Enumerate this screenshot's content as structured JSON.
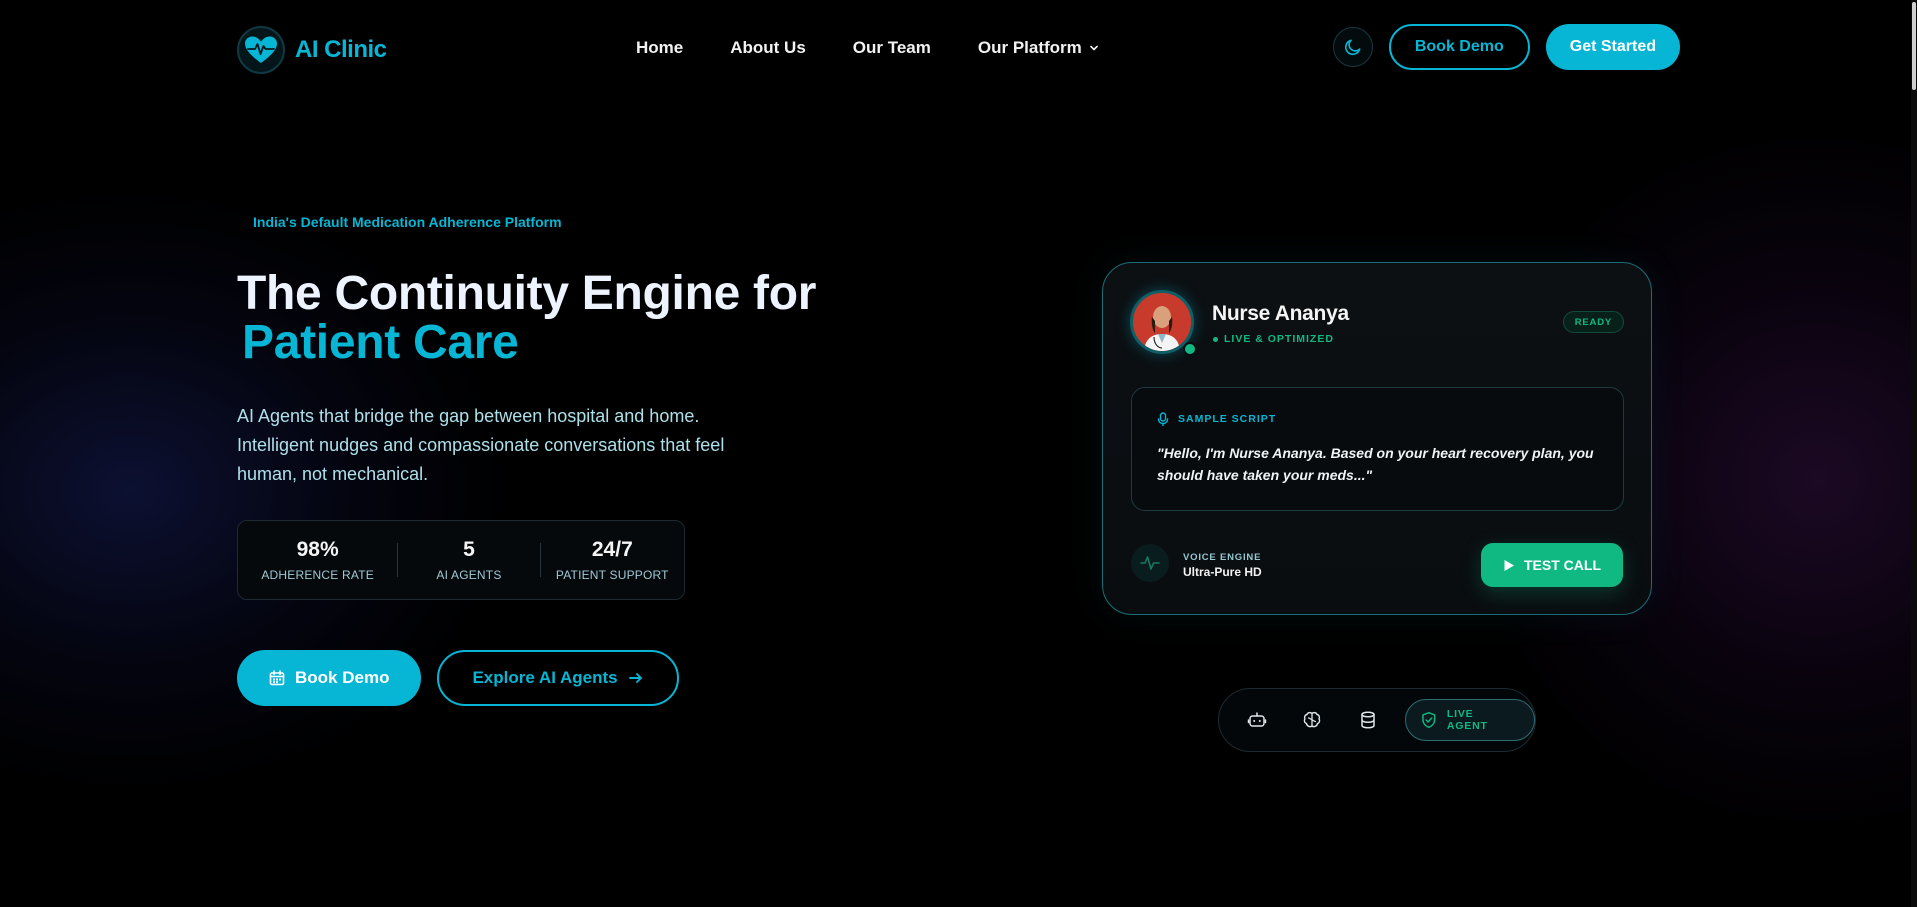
{
  "brand": {
    "name": "AI Clinic",
    "logo_icon": "heart-pulse-icon",
    "color": "#06b6d4"
  },
  "nav": {
    "links": [
      {
        "label": "Home"
      },
      {
        "label": "About Us"
      },
      {
        "label": "Our Team"
      },
      {
        "label": "Our Platform",
        "has_dropdown": true
      }
    ],
    "theme_toggle_icon": "moon-icon",
    "book_demo": "Book Demo",
    "get_started": "Get Started"
  },
  "hero": {
    "eyebrow": "India's Default Medication Adherence Platform",
    "title_line1": "The Continuity Engine for",
    "title_line2": "Patient Care",
    "subtitle": "AI Agents that bridge the gap between hospital and home. Intelligent nudges and compassionate conversations that feel human, not mechanical.",
    "stats": [
      {
        "value": "98%",
        "label": "ADHERENCE RATE"
      },
      {
        "value": "5",
        "label": "AI AGENTS"
      },
      {
        "value": "24/7",
        "label": "PATIENT SUPPORT"
      }
    ],
    "cta_primary": "Book Demo",
    "cta_primary_icon": "calendar-icon",
    "cta_secondary": "Explore AI Agents",
    "cta_secondary_icon": "arrow-right-icon"
  },
  "agent_card": {
    "name": "Nurse Ananya",
    "status": "LIVE & OPTIMIZED",
    "badge": "READY",
    "script_label": "SAMPLE SCRIPT",
    "script_text": "\"Hello, I'm Nurse Ananya. Based on your heart recovery plan, you should have taken your meds...\"",
    "engine_label": "VOICE ENGINE",
    "engine_value": "Ultra-Pure HD",
    "test_call": "TEST CALL",
    "colors": {
      "accent": "#06b6d4",
      "success": "#10b981"
    }
  },
  "agent_tabs": {
    "icons": [
      "bot-icon",
      "brain-icon",
      "database-icon"
    ],
    "active_label": "LIVE AGENT",
    "active_icon": "shield-check-icon"
  }
}
